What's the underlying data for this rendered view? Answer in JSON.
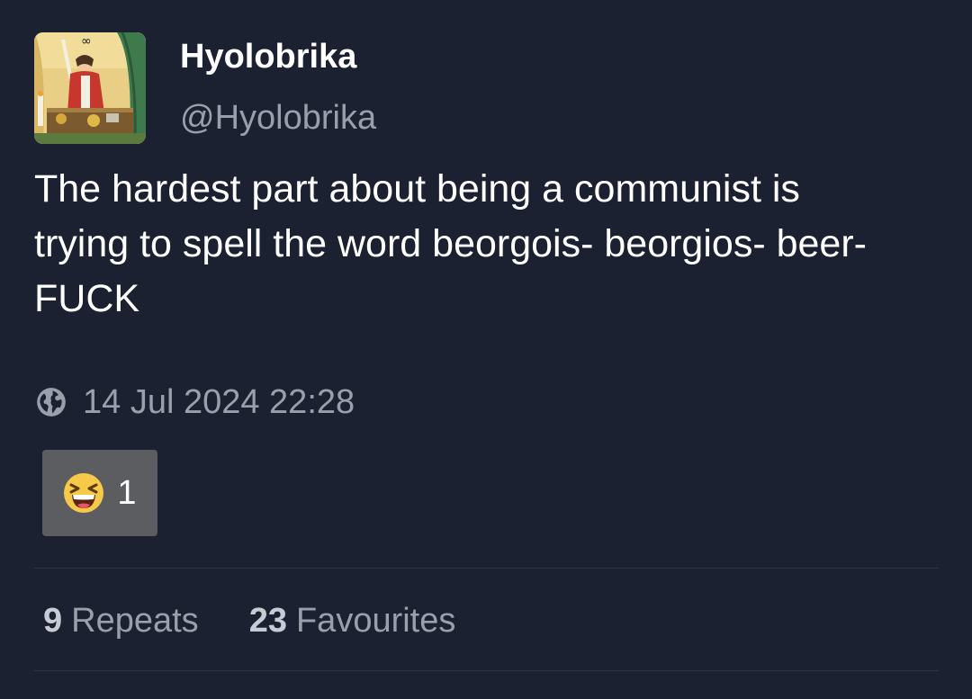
{
  "author": {
    "display_name": "Hyolobrika",
    "handle": "@Hyolobrika",
    "avatar_icon": "tarot-magician-avatar"
  },
  "post": {
    "text_lines": [
      "The hardest part about being a communist is",
      "trying to spell the word beorgois- beorgios- beer-",
      "FUCK"
    ],
    "visibility_icon": "globe-icon",
    "timestamp": "14 Jul 2024 22:28"
  },
  "reactions": [
    {
      "emoji_icon": "laughing-face-emoji",
      "count": "1"
    }
  ],
  "stats": {
    "repeats_count": "9",
    "repeats_label": "Repeats",
    "favourites_count": "23",
    "favourites_label": "Favourites"
  },
  "colors": {
    "background": "#1b2130",
    "muted_text": "#9aa0ab",
    "reaction_bg": "#5c5d60",
    "divider": "#2c3342"
  }
}
